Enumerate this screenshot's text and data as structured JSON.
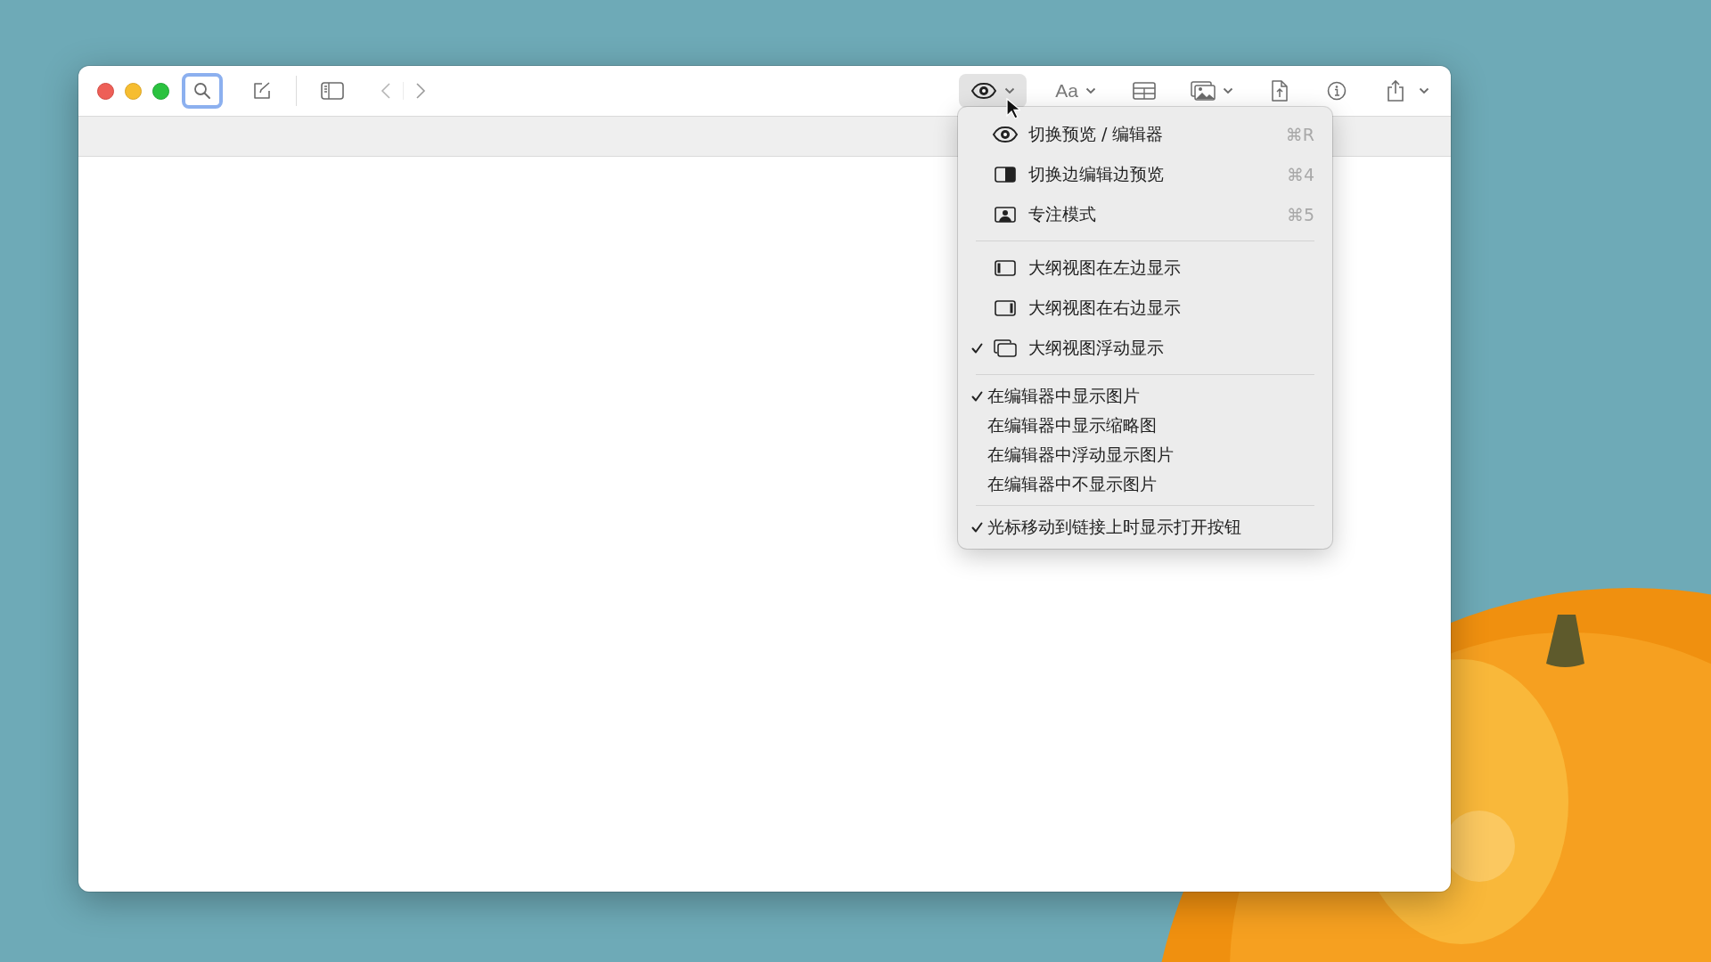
{
  "toolbar": {
    "search_focused": true,
    "view_button_pressed": true,
    "font_button": "Aa"
  },
  "menu": {
    "sections": [
      {
        "items": [
          {
            "kind": "icon",
            "label": "切换预览 / 编辑器",
            "shortcut": "⌘R",
            "checked": false
          },
          {
            "kind": "icon",
            "label": "切换边编辑边预览",
            "shortcut": "⌘4",
            "checked": false
          },
          {
            "kind": "icon",
            "label": "专注模式",
            "shortcut": "⌘5",
            "checked": false
          }
        ]
      },
      {
        "items": [
          {
            "kind": "icon",
            "label": "大纲视图在左边显示",
            "checked": false
          },
          {
            "kind": "icon",
            "label": "大纲视图在右边显示",
            "checked": false
          },
          {
            "kind": "icon",
            "label": "大纲视图浮动显示",
            "checked": true
          }
        ]
      },
      {
        "items": [
          {
            "kind": "plain",
            "label": "在编辑器中显示图片",
            "checked": true
          },
          {
            "kind": "plain",
            "label": "在编辑器中显示缩略图",
            "checked": false
          },
          {
            "kind": "plain",
            "label": "在编辑器中浮动显示图片",
            "checked": false
          },
          {
            "kind": "plain",
            "label": "在编辑器中不显示图片",
            "checked": false
          }
        ]
      },
      {
        "items": [
          {
            "kind": "plain",
            "label": "光标移动到链接上时显示打开按钮",
            "checked": true
          }
        ]
      }
    ]
  }
}
